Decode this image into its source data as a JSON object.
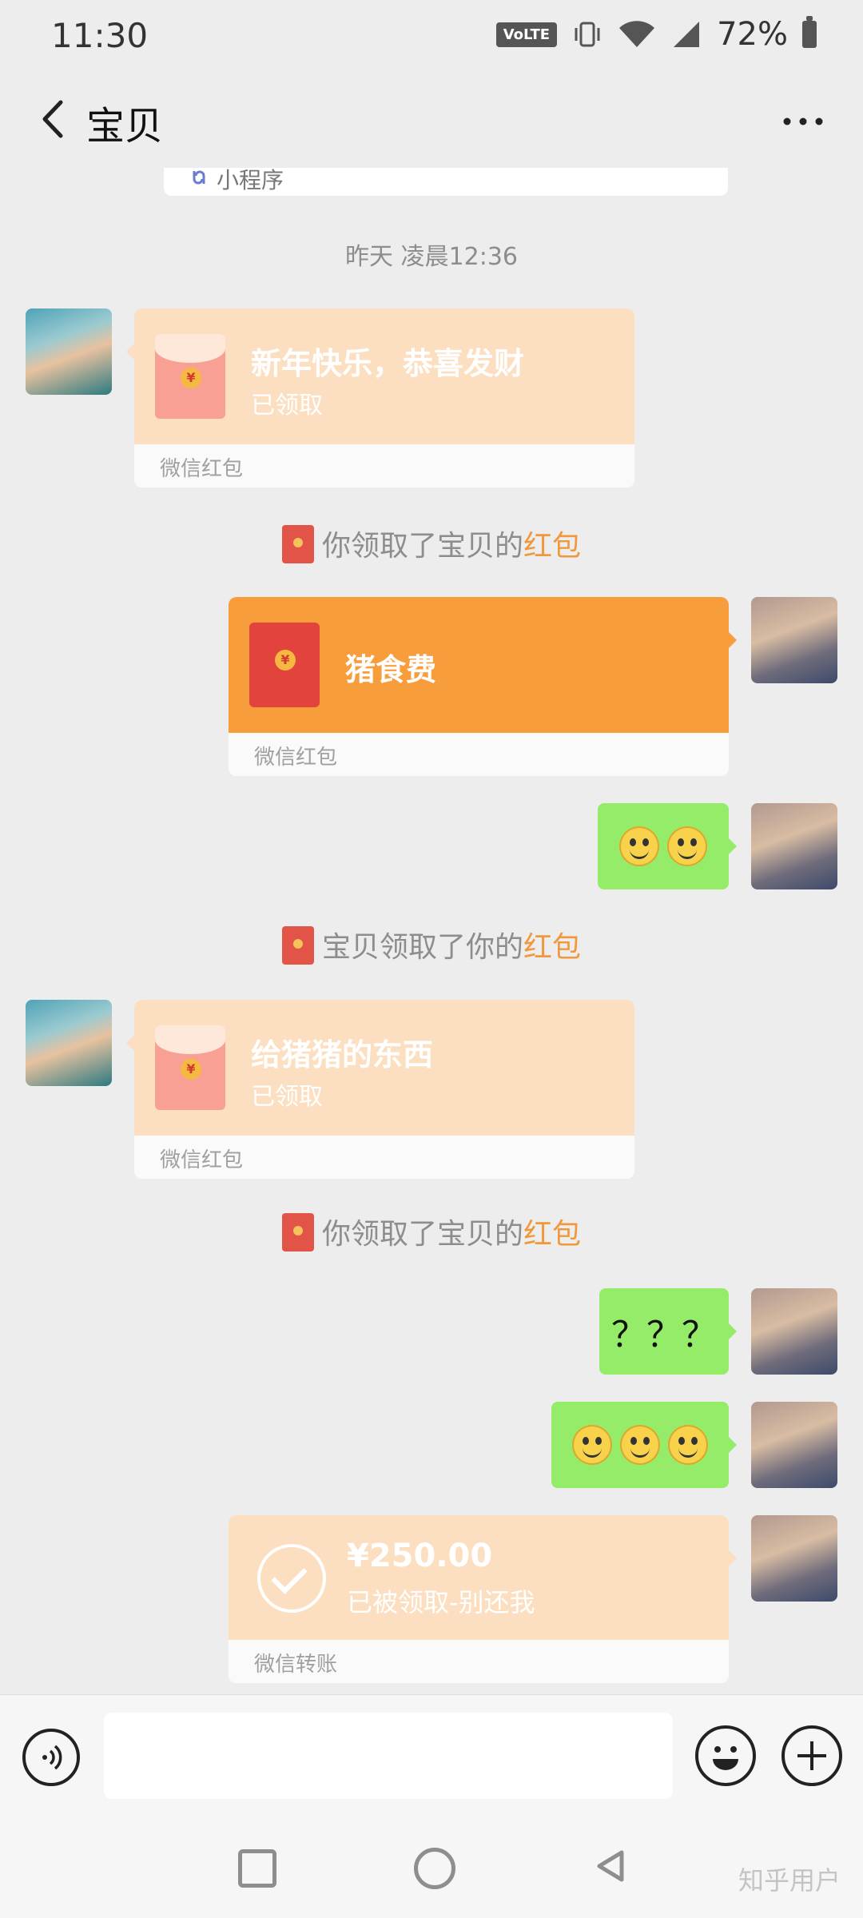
{
  "status_bar": {
    "time": "11:30",
    "network_badge": "VoLTE",
    "battery": "72%"
  },
  "header": {
    "title": "宝贝"
  },
  "chat": {
    "mini_program_label": "小程序",
    "timestamp": "昨天 凌晨12:36",
    "messages": [
      {
        "type": "red_packet_received",
        "side": "left",
        "title": "新年快乐，恭喜发财",
        "status": "已领取",
        "footer": "微信红包"
      },
      {
        "type": "system",
        "text_prefix": "你领取了宝贝的",
        "link": "红包"
      },
      {
        "type": "red_packet_sent",
        "side": "right",
        "title": "猪食费",
        "footer": "微信红包"
      },
      {
        "type": "emoji",
        "side": "right",
        "emoji": [
          "smile",
          "smile"
        ]
      },
      {
        "type": "system",
        "text_prefix": "宝贝领取了你的",
        "link": "红包"
      },
      {
        "type": "red_packet_received",
        "side": "left",
        "title": "给猪猪的东西",
        "status": "已领取",
        "footer": "微信红包"
      },
      {
        "type": "system",
        "text_prefix": "你领取了宝贝的",
        "link": "红包"
      },
      {
        "type": "text",
        "side": "right",
        "text": "？？？"
      },
      {
        "type": "emoji",
        "side": "right",
        "emoji": [
          "smile",
          "smile",
          "smile"
        ]
      },
      {
        "type": "transfer",
        "side": "right",
        "amount": "¥250.00",
        "note": "已被领取-别还我",
        "footer": "微信转账"
      }
    ]
  },
  "watermark": "知乎用户",
  "colors": {
    "green_bubble": "#95ec69",
    "red_packet_sent": "#f89d3b",
    "red_packet_received": "#fbdfc0",
    "link": "#f0983b"
  }
}
